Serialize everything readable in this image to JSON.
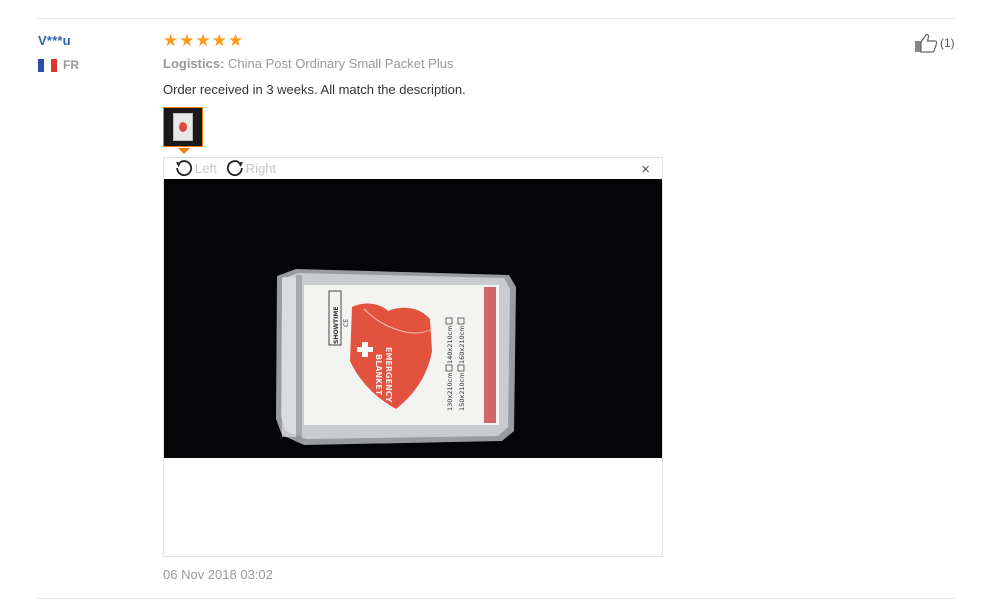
{
  "user": {
    "name": "V***u",
    "country": "FR"
  },
  "review": {
    "rating": 5,
    "logistics_label": "Logistics:",
    "logistics_value": "China Post Ordinary Small Packet Plus",
    "text": "Order received in 3 weeks. All match the description.",
    "date": "06 Nov 2018 03:02"
  },
  "viewer": {
    "rotate_left_label": "Left",
    "rotate_right_label": "Right",
    "close_symbol": "×",
    "photo_texts": {
      "brand": "SHOWTIME",
      "ce": "CE",
      "title_line1": "EMERGENCY",
      "title_line2": "BLANKET",
      "size1": "130x210cm",
      "size2": "140x210cm",
      "size3": "150x210cm",
      "size4": "160x210cm"
    }
  },
  "like": {
    "count": "(1)"
  },
  "icons": {
    "star": "star-icon",
    "thumbs_up": "thumbs-up-icon",
    "rotate_left": "rotate-left-icon",
    "rotate_right": "rotate-right-icon",
    "close": "close-icon",
    "flag": "flag-fr-icon"
  },
  "colors": {
    "username": "#2a66b8",
    "star": "#f89a1c",
    "thumb_border": "#f57c00",
    "muted_text": "#999999"
  }
}
